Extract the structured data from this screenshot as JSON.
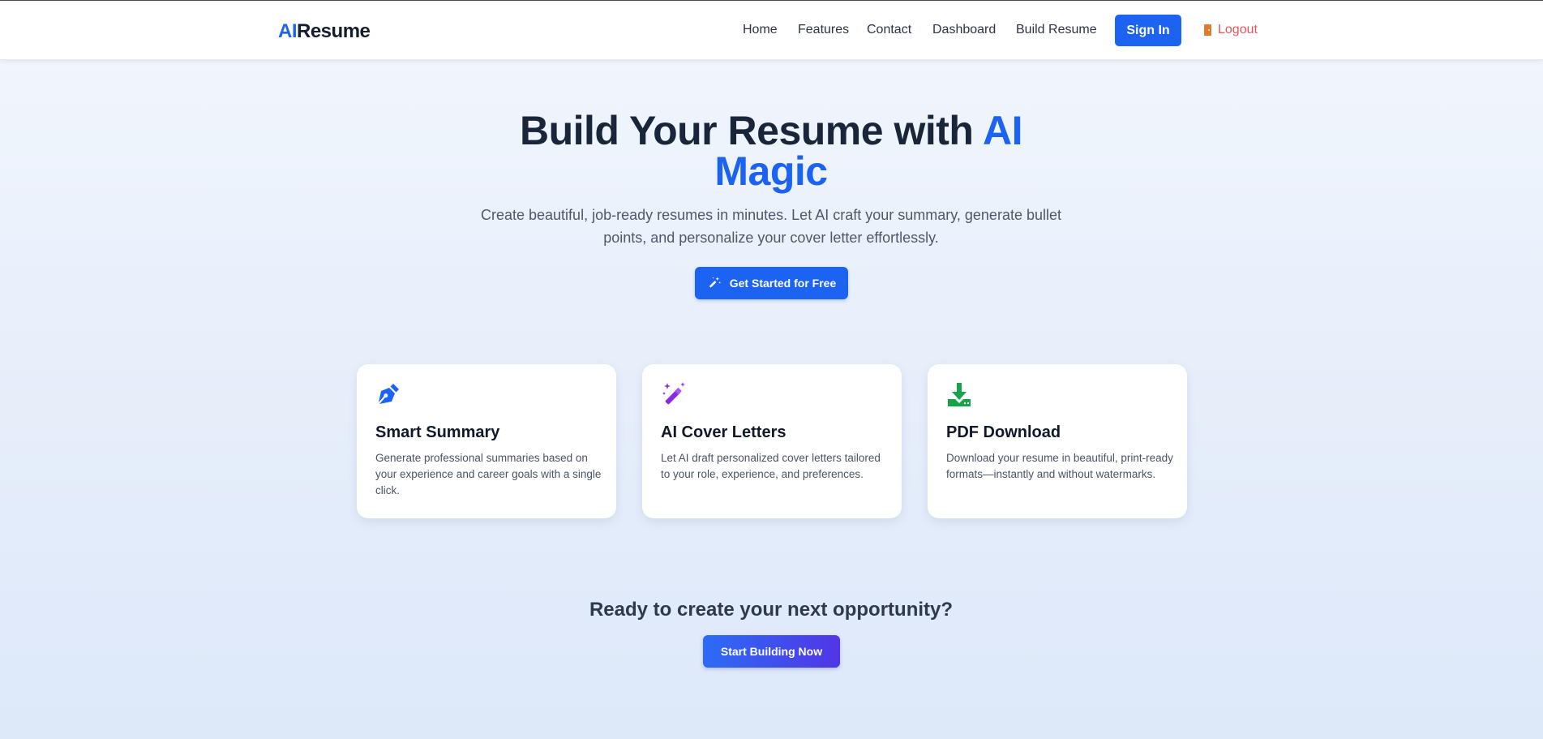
{
  "navbar": {
    "brand_accent": "AI",
    "brand_rest": "Resume",
    "links": [
      {
        "label": "Home"
      },
      {
        "label": "Features"
      },
      {
        "label": "Contact"
      },
      {
        "label": "Dashboard"
      },
      {
        "label": "Build Resume"
      }
    ],
    "signin_label": "Sign In",
    "logout_label": "Logout",
    "logout_icon": "door-icon"
  },
  "hero": {
    "title_main": "Build Your Resume with",
    "title_accent_1": "AI",
    "title_accent_2": "Magic",
    "subtitle": "Create beautiful, job-ready resumes in minutes. Let AI craft your summary, generate bullet points, and personalize your cover letter effortlessly.",
    "cta_label": "Get Started for Free",
    "cta_icon": "magic-wand-icon"
  },
  "features": [
    {
      "icon": "pen-nib-icon",
      "title": "Smart Summary",
      "description": "Generate professional summaries based on your experience and career goals with a single click."
    },
    {
      "icon": "magic-wand-icon",
      "title": "AI Cover Letters",
      "description": "Let AI draft personalized cover letters tailored to your role, experience, and preferences."
    },
    {
      "icon": "download-icon",
      "title": "PDF Download",
      "description": "Download your resume in beautiful, print-ready formats—instantly and without watermarks."
    }
  ],
  "bottom": {
    "heading": "Ready to create your next opportunity?",
    "cta_label": "Start Building Now"
  },
  "colors": {
    "primary": "#1c63f2",
    "logout": "#e5565b",
    "icon_blue": "#1c63f2",
    "icon_purple": "#8a2be2",
    "icon_green": "#16a34a"
  }
}
